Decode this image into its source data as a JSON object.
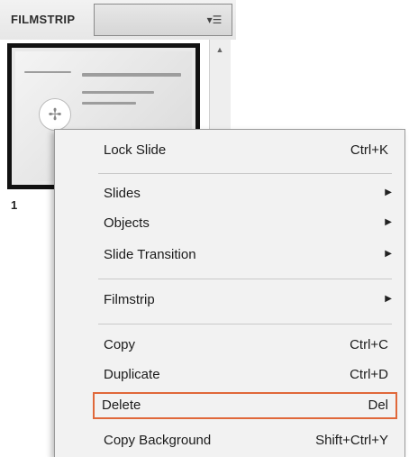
{
  "filmstrip": {
    "title": "FILMSTRIP",
    "menu_icon": "panel-menu-icon",
    "slide_number": "1"
  },
  "context_menu": {
    "items": [
      {
        "label": "Lock Slide",
        "shortcut": "Ctrl+K"
      },
      {
        "label": "Slides",
        "submenu": true
      },
      {
        "label": "Objects",
        "submenu": true
      },
      {
        "label": "Slide Transition",
        "submenu": true
      },
      {
        "label": "Filmstrip",
        "submenu": true
      },
      {
        "label": "Copy",
        "shortcut": "Ctrl+C"
      },
      {
        "label": "Duplicate",
        "shortcut": "Ctrl+D"
      },
      {
        "label": "Delete",
        "shortcut": "Del",
        "highlighted": true
      },
      {
        "label": "Copy Background",
        "shortcut": "Shift+Ctrl+Y"
      }
    ],
    "highlight_color": "#e0683a"
  }
}
